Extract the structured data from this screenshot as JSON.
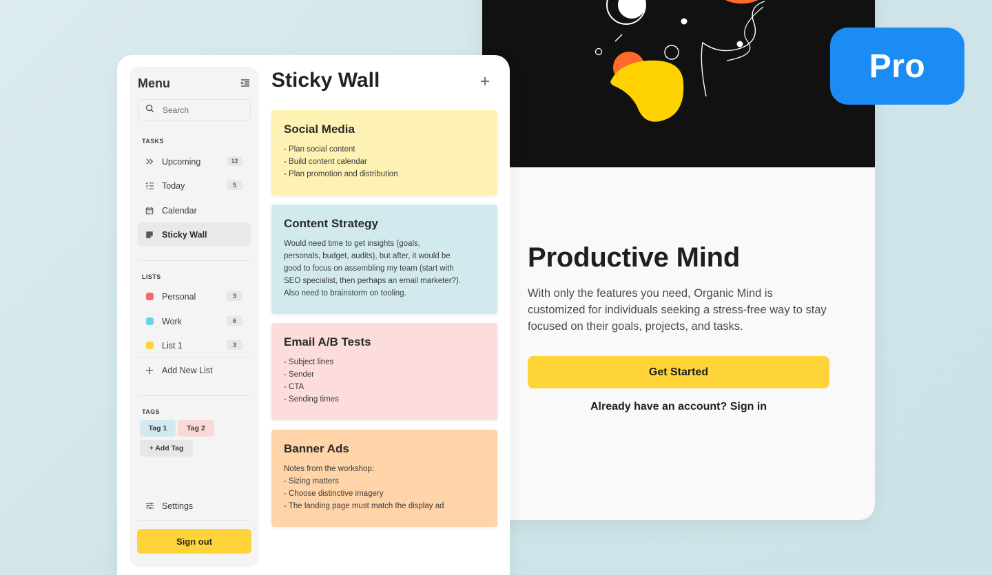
{
  "landing": {
    "title": "Productive Mind",
    "description": "With only the features you need, Organic Mind is customized for individuals seeking a stress-free way to stay focused on their goals, projects, and tasks.",
    "cta_label": "Get Started",
    "signin_text": "Already have an account? Sign in"
  },
  "badge": {
    "label": "Pro",
    "color": "#1c8cf5"
  },
  "sidebar": {
    "title": "Menu",
    "search_placeholder": "Search",
    "tasks_label": "TASKS",
    "tasks": [
      {
        "label": "Upcoming",
        "count": "12",
        "icon": "double-chevron-icon"
      },
      {
        "label": "Today",
        "count": "5",
        "icon": "checklist-icon"
      },
      {
        "label": "Calendar",
        "count": "",
        "icon": "calendar-icon"
      },
      {
        "label": "Sticky Wall",
        "count": "",
        "icon": "sticky-note-icon"
      }
    ],
    "lists_label": "LISTS",
    "lists": [
      {
        "label": "Personal",
        "count": "3",
        "color": "#f26a6a"
      },
      {
        "label": "Work",
        "count": "6",
        "color": "#6ad3e8"
      },
      {
        "label": "List 1",
        "count": "3",
        "color": "#fed438"
      }
    ],
    "add_list_label": "Add New List",
    "tags_label": "TAGS",
    "tags": [
      {
        "label": "Tag 1",
        "color": "#d2eaef"
      },
      {
        "label": "Tag 2",
        "color": "#fcd9d9"
      }
    ],
    "add_tag_label": "+ Add Tag",
    "settings_label": "Settings",
    "signout_label": "Sign out"
  },
  "wall": {
    "title": "Sticky Wall",
    "add_icon": "plus-icon",
    "notes": [
      {
        "title": "Social Media",
        "color": "#fdf2b3",
        "lines": [
          "- Plan social content",
          "- Build content calendar",
          "- Plan promotion and distribution"
        ]
      },
      {
        "title": "Content Strategy",
        "color": "#d2eaee",
        "lines": [
          "Would need time to get insights (goals,",
          "personals, budget, audits), but after, it would be",
          "good to focus on assembling my team (start with",
          "SEO specialist, then perhaps an email marketer?).",
          "Also need to brainstorm on tooling."
        ]
      },
      {
        "title": "Email A/B Tests",
        "color": "#fcdcdc",
        "lines": [
          "- Subject lines",
          "- Sender",
          "- CTA",
          "- Sending times"
        ]
      },
      {
        "title": "Banner Ads",
        "color": "#fed4a8",
        "lines": [
          "Notes from the workshop:",
          "- Sizing matters",
          "- Choose distinctive imagery",
          "- The landing page must match the display ad"
        ]
      }
    ]
  }
}
